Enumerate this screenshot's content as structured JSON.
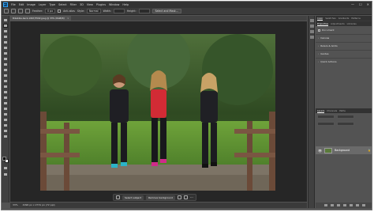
{
  "menu": {
    "logo": "Ps",
    "items": [
      "File",
      "Edit",
      "Image",
      "Layer",
      "Type",
      "Select",
      "Filter",
      "3D",
      "View",
      "Plugins",
      "Window",
      "Help"
    ],
    "window_controls": [
      "—",
      "☐",
      "✕"
    ]
  },
  "options": {
    "feather_label": "Feather:",
    "feather_value": "0 px",
    "antialias_label": "Anti-alias",
    "style_label": "Style:",
    "style_value": "Normal",
    "width_label": "Width:",
    "height_label": "Height:",
    "select_mask_button": "Select and Mask..."
  },
  "document": {
    "tab_title": "Bikebike-back-1967/3592.jpeg @ 33% (RGB/8/)",
    "close_glyph": "×"
  },
  "context_bar": {
    "select_subject": "Select subject",
    "remove_background": "Remove background",
    "more": "···"
  },
  "status": {
    "zoom": "33%",
    "info": "4096 px x 2731 px (72 ppi)"
  },
  "properties_panel": {
    "tabs": [
      "Color",
      "Swatches",
      "Gradients",
      "Patterns"
    ],
    "sub_tabs": [
      "Properties",
      "Adjustments",
      "Libraries"
    ],
    "doc_label": "Document",
    "sections": [
      "Canvas",
      "Rulers & Grids",
      "Guides",
      "Quick Actions"
    ]
  },
  "layers_panel": {
    "tabs": [
      "Layers",
      "Channels",
      "Paths"
    ],
    "layer_name": "Background",
    "eye": "👁",
    "lock": "🔒"
  },
  "colors": {
    "accent": "#31a8ff",
    "panel": "#535353",
    "app_bg": "#262626"
  }
}
